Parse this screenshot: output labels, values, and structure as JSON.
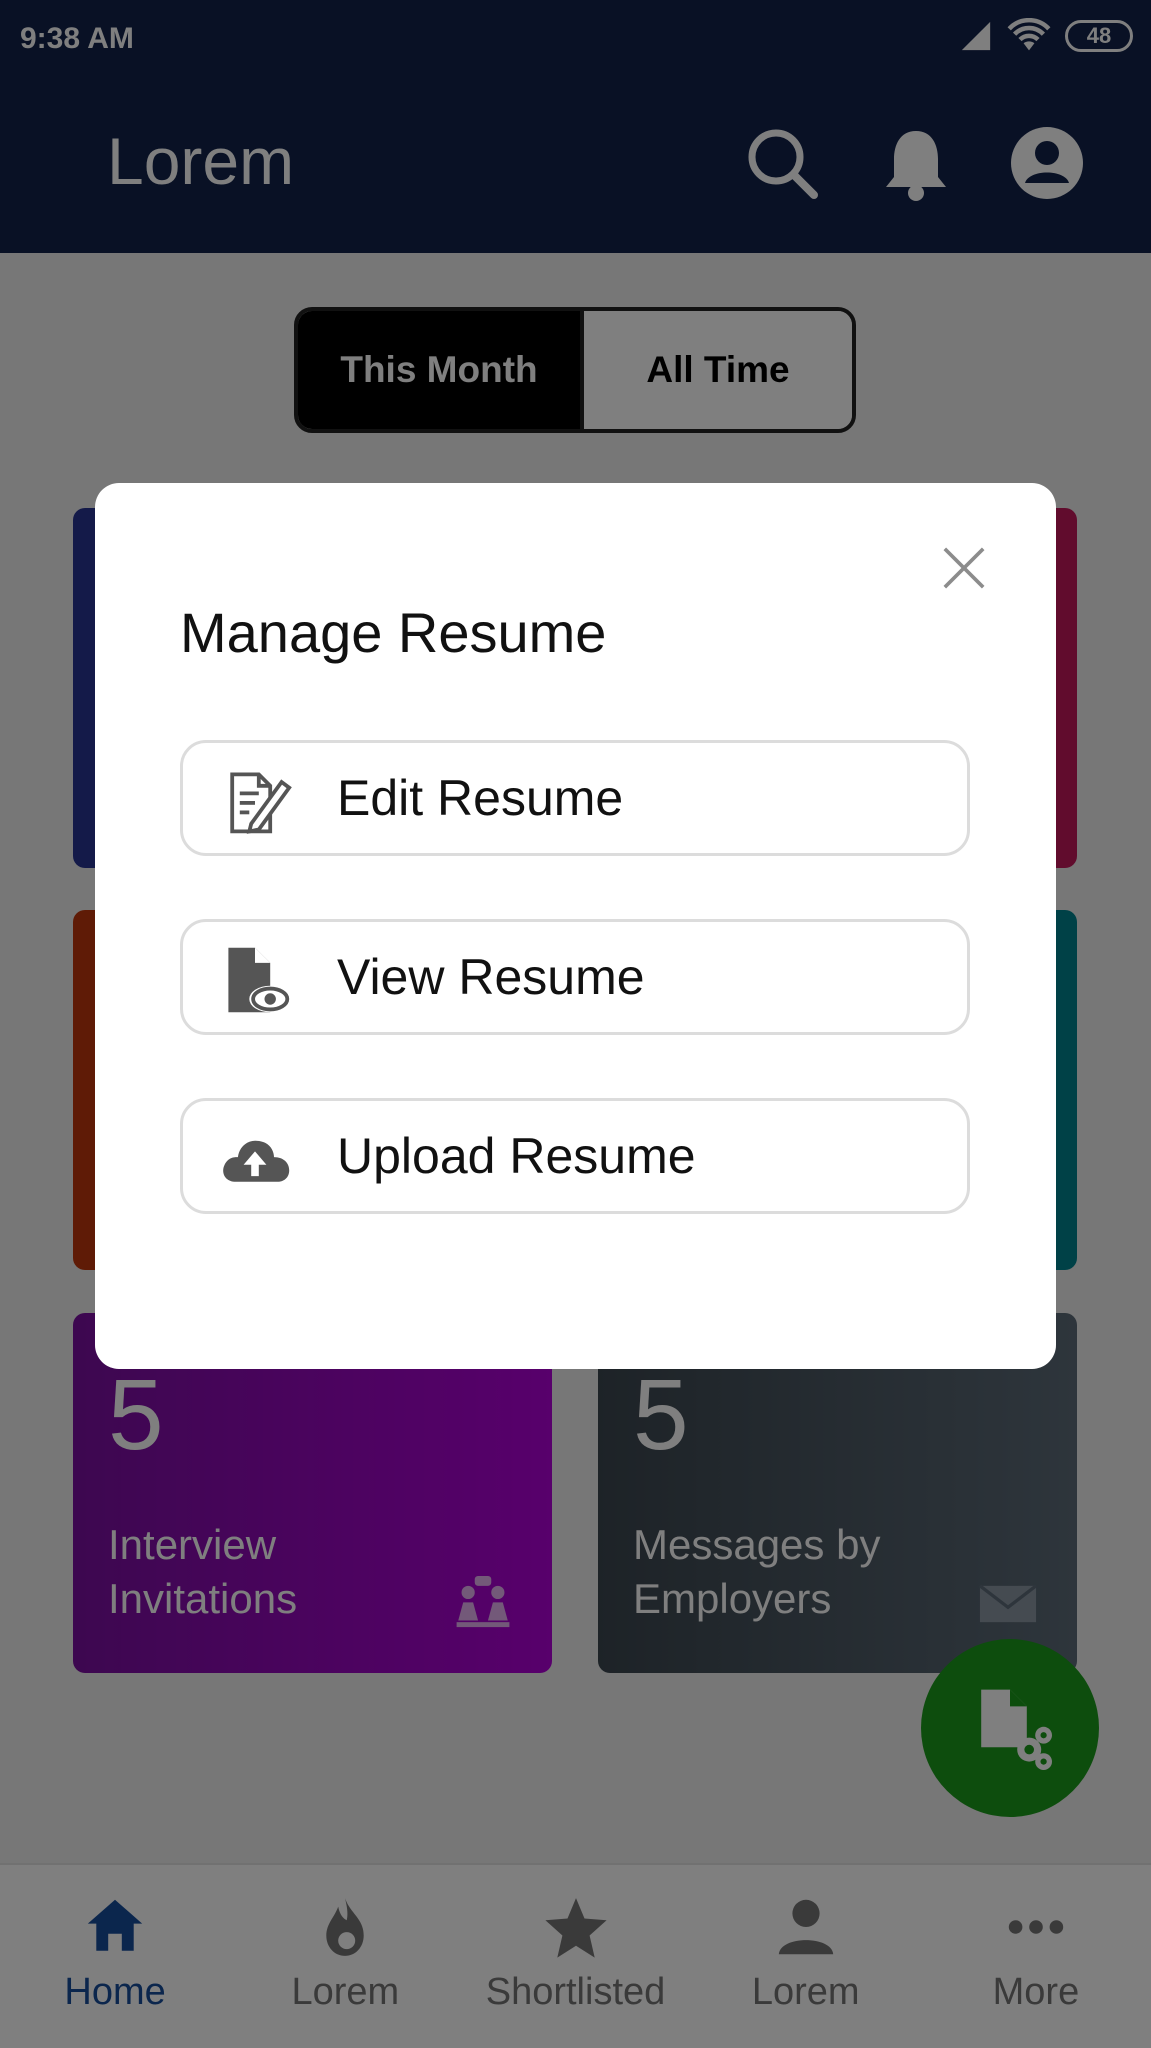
{
  "status": {
    "time": "9:38 AM",
    "battery": "48"
  },
  "appbar": {
    "title": "Lorem",
    "icons": [
      "search-icon",
      "bell-icon",
      "account-icon"
    ]
  },
  "segment": {
    "active": "This Month",
    "inactive": "All Time"
  },
  "cards": [
    {
      "value": "5",
      "label": "Interview Invitations",
      "icon": "interview-icon",
      "color": "#6a0a8c"
    },
    {
      "value": "5",
      "label": "Messages by Employers",
      "icon": "mail-icon",
      "color": "#4a5560"
    }
  ],
  "card_accent_colors": [
    "#283593",
    "#c2185b",
    "#bf360c",
    "#00838f"
  ],
  "fab": {
    "icon": "resume-settings-icon",
    "color": "#1b9a1b"
  },
  "bottom_nav": [
    {
      "label": "Home",
      "icon": "home-icon",
      "active": true
    },
    {
      "label": "Lorem",
      "icon": "flame-icon"
    },
    {
      "label": "Shortlisted",
      "icon": "star-icon"
    },
    {
      "label": "Lorem",
      "icon": "person-icon"
    },
    {
      "label": "More",
      "icon": "more-icon"
    }
  ],
  "dialog": {
    "title": "Manage Resume",
    "close_icon": "close-icon",
    "buttons": [
      {
        "label": "Edit Resume",
        "icon": "edit-document-icon"
      },
      {
        "label": "View Resume",
        "icon": "view-document-icon"
      },
      {
        "label": "Upload Resume",
        "icon": "cloud-upload-icon"
      }
    ]
  },
  "colors": {
    "primary": "#12224a",
    "nav_active": "#174d9b",
    "fab": "#1b9a1b"
  }
}
